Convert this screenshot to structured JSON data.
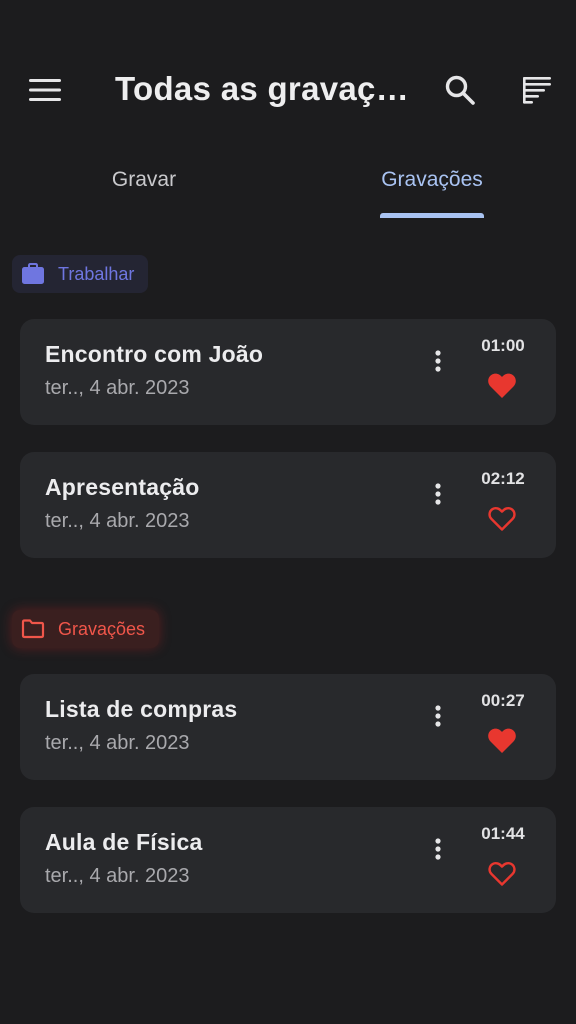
{
  "header": {
    "title": "Todas as gravaçõ…",
    "menu_icon": "menu-icon",
    "search_icon": "search-icon",
    "sort_icon": "sort-icon"
  },
  "tabs": [
    {
      "label": "Gravar",
      "active": false
    },
    {
      "label": "Gravações",
      "active": true
    }
  ],
  "colors": {
    "background": "#1c1c1e",
    "card": "#28292c",
    "accent": "#a9c3f2",
    "work_folder": "#6f76e0",
    "recordings_folder": "#f0564a",
    "heart": "#e8372f"
  },
  "groups": [
    {
      "folder": {
        "label": "Trabalhar",
        "icon": "briefcase-icon"
      },
      "items": [
        {
          "title": "Encontro com João",
          "date": "ter.., 4 abr. 2023",
          "duration": "01:00",
          "favorite": true
        },
        {
          "title": "Apresentação",
          "date": "ter.., 4 abr. 2023",
          "duration": "02:12",
          "favorite": false
        }
      ]
    },
    {
      "folder": {
        "label": "Gravações",
        "icon": "folder-icon"
      },
      "items": [
        {
          "title": "Lista de compras",
          "date": "ter.., 4 abr. 2023",
          "duration": "00:27",
          "favorite": true
        },
        {
          "title": "Aula de Física",
          "date": "ter.., 4 abr. 2023",
          "duration": "01:44",
          "favorite": false
        }
      ]
    }
  ]
}
